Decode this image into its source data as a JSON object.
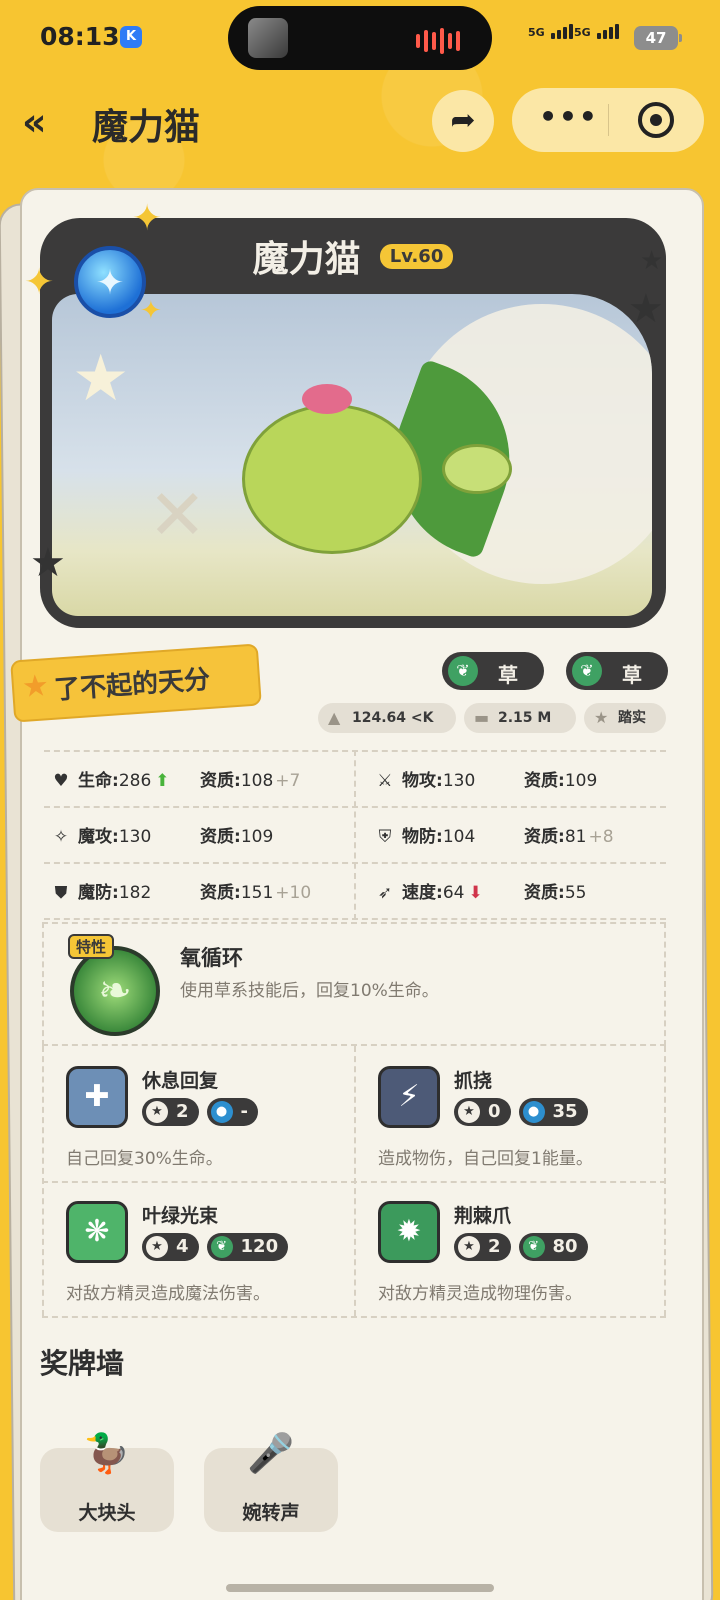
{
  "status": {
    "time": "08:13",
    "k_badge": "K",
    "signal1": "5G",
    "signal2": "5G",
    "battery": "47"
  },
  "nav": {
    "back_glyph": "«",
    "title": "魔力猫",
    "share_glyph": "➦",
    "more_glyph": "•••"
  },
  "pet": {
    "name": "魔力猫",
    "level": "Lv.60",
    "talent": "了不起的天分",
    "types": [
      "草",
      "草"
    ],
    "measures": [
      {
        "icon": "weight-icon",
        "text": "124.64 <K"
      },
      {
        "icon": "ruler-icon",
        "text": "2.15 M"
      },
      {
        "icon": "star-icon",
        "text": "踏实"
      }
    ]
  },
  "stats": [
    {
      "label": "生命",
      "value": "286",
      "trend": "up",
      "apt_label": "资质",
      "apt": "108",
      "bonus": "+7"
    },
    {
      "label": "物攻",
      "value": "130",
      "trend": "",
      "apt_label": "资质",
      "apt": "109",
      "bonus": ""
    },
    {
      "label": "魔攻",
      "value": "130",
      "trend": "",
      "apt_label": "资质",
      "apt": "109",
      "bonus": ""
    },
    {
      "label": "物防",
      "value": "104",
      "trend": "",
      "apt_label": "资质",
      "apt": "81",
      "bonus": "+8"
    },
    {
      "label": "魔防",
      "value": "182",
      "trend": "",
      "apt_label": "资质",
      "apt": "151",
      "bonus": "+10"
    },
    {
      "label": "速度",
      "value": "64",
      "trend": "down",
      "apt_label": "资质",
      "apt": "55",
      "bonus": ""
    }
  ],
  "ability": {
    "tag": "特性",
    "name": "氧循环",
    "desc": "使用草系技能后，回复10%生命。"
  },
  "skills": [
    {
      "name": "休息回复",
      "cost": "2",
      "power": "-",
      "power_type": "energy",
      "desc": "自己回复30%生命。",
      "color": "#6d8fb6"
    },
    {
      "name": "抓挠",
      "cost": "0",
      "power": "35",
      "power_type": "energy",
      "desc": "造成物伤，自己回复1能量。",
      "color": "#4d5a77"
    },
    {
      "name": "叶绿光束",
      "cost": "4",
      "power": "120",
      "power_type": "grass",
      "desc": "对敌方精灵造成魔法伤害。",
      "color": "#4fb46a"
    },
    {
      "name": "荆棘爪",
      "cost": "2",
      "power": "80",
      "power_type": "grass",
      "desc": "对敌方精灵造成物理伤害。",
      "color": "#3c9a5c"
    }
  ],
  "medals": {
    "title": "奖牌墙",
    "items": [
      {
        "label": "大块头",
        "icon": "duck-trophy-icon",
        "glyph": "🦆"
      },
      {
        "label": "婉转声",
        "icon": "singer-trophy-icon",
        "glyph": "🎤"
      }
    ]
  }
}
